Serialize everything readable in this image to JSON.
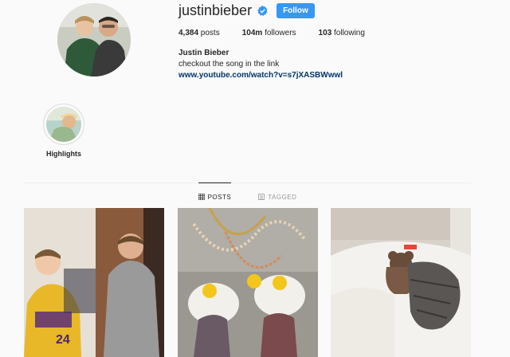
{
  "profile": {
    "username": "justinbieber",
    "follow_label": "Follow",
    "full_name": "Justin Bieber",
    "bio": "checkout the song in the link",
    "link": "www.youtube.com/watch?v=s7jXASBWwwl",
    "verified_icon": "verified-badge-icon"
  },
  "stats": {
    "posts": "4,384",
    "posts_label": " posts",
    "followers": "104m",
    "followers_label": " followers",
    "following": "103",
    "following_label": " following"
  },
  "highlights": [
    {
      "label": "Highlights"
    }
  ],
  "tabs": [
    {
      "label": "POSTS",
      "icon": "grid-icon",
      "active": true
    },
    {
      "label": "TAGGED",
      "icon": "tag-icon",
      "active": false
    }
  ],
  "colors": {
    "accent": "#3897f0",
    "link": "#003569",
    "background": "#fafafa"
  }
}
